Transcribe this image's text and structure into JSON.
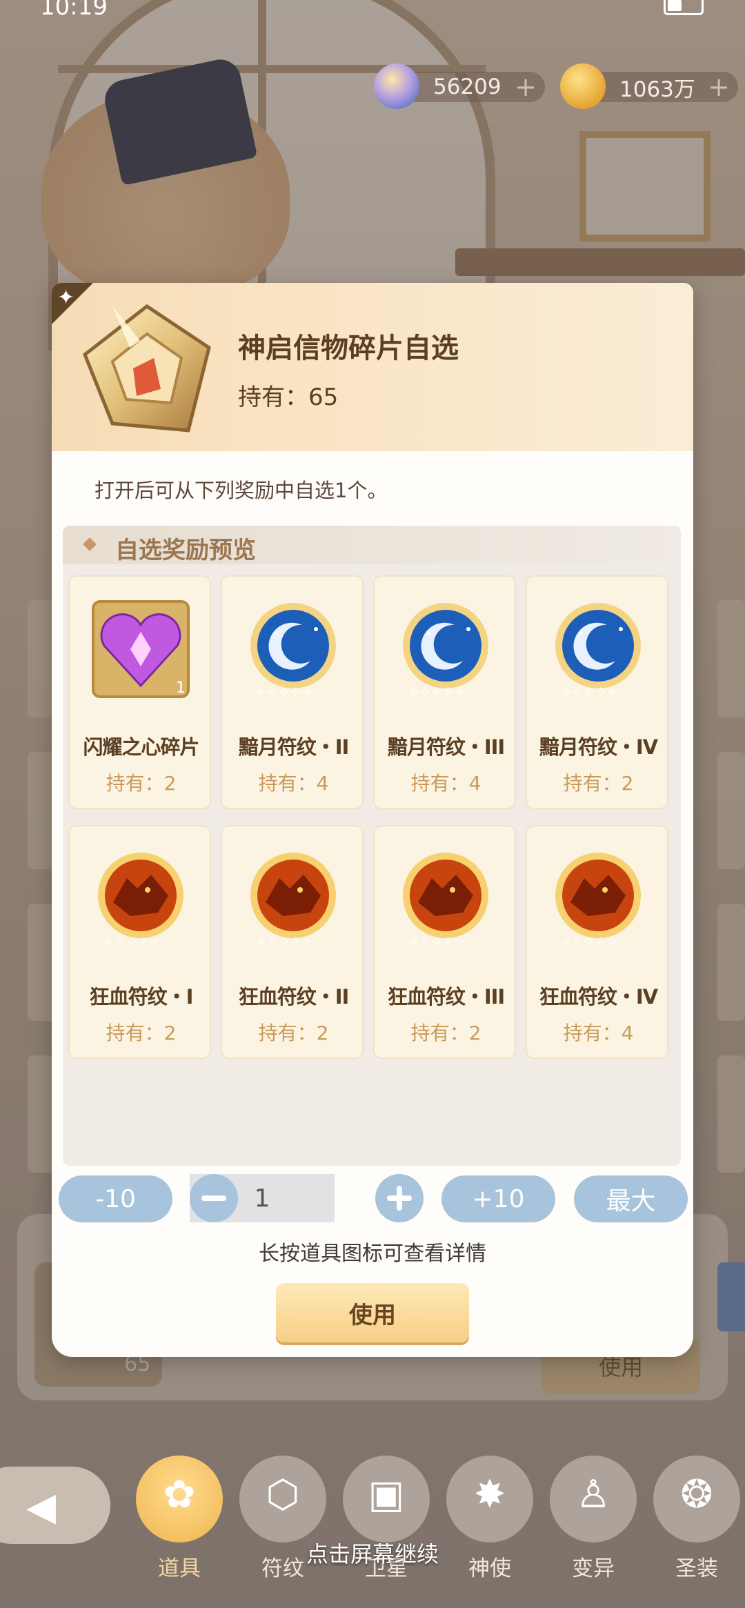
{
  "status_bar": {
    "time": "10:19"
  },
  "currency": [
    {
      "icon": "rainbow-gem-icon",
      "value": "56209",
      "plus": "+"
    },
    {
      "icon": "paw-coin-icon",
      "value": "1063万",
      "plus": "+"
    }
  ],
  "modal": {
    "item_name": "神启信物碎片自选",
    "holding": "持有：65",
    "description": "打开后可从下列奖励中自选1个。",
    "reward_section_title": "自选奖励预览",
    "rewards": [
      {
        "name": "闪耀之心碎片",
        "holding": "持有：2",
        "icon": "heart-crystal-shard-icon",
        "count": "1"
      },
      {
        "name": "黯月符纹・II",
        "holding": "持有：4",
        "icon": "moon-rune-icon"
      },
      {
        "name": "黯月符纹・III",
        "holding": "持有：4",
        "icon": "moon-rune-icon"
      },
      {
        "name": "黯月符纹・IV",
        "holding": "持有：2",
        "icon": "moon-rune-icon"
      },
      {
        "name": "狂血符纹・I",
        "holding": "持有：2",
        "icon": "wolf-rune-icon"
      },
      {
        "name": "狂血符纹・II",
        "holding": "持有：2",
        "icon": "wolf-rune-icon"
      },
      {
        "name": "狂血符纹・III",
        "holding": "持有：2",
        "icon": "wolf-rune-icon"
      },
      {
        "name": "狂血符纹・IV",
        "holding": "持有：4",
        "icon": "wolf-rune-icon"
      }
    ],
    "quantity": {
      "minus_ten": "-10",
      "value": "1",
      "plus_ten": "+10",
      "max": "最大"
    },
    "hint": "长按道具图标可查看详情",
    "use_button": "使用"
  },
  "background": {
    "bottom_item_count": "65",
    "bottom_use_button": "使用"
  },
  "bottom_nav": [
    {
      "label": "道具",
      "icon": "item-bag-icon",
      "active": true
    },
    {
      "label": "符纹",
      "icon": "rune-icon"
    },
    {
      "label": "卫星",
      "icon": "cards-icon"
    },
    {
      "label": "神使",
      "icon": "emblem-icon"
    },
    {
      "label": "变异",
      "icon": "figure-icon"
    },
    {
      "label": "圣装",
      "icon": "equipment-icon"
    }
  ],
  "continue_hint": "点击屏幕继续",
  "colors": {
    "accent_gold": "#f1b451",
    "button_blue": "#a8c4dd",
    "title_brown": "#5b3f22",
    "holding_gold": "#c99a5a"
  }
}
